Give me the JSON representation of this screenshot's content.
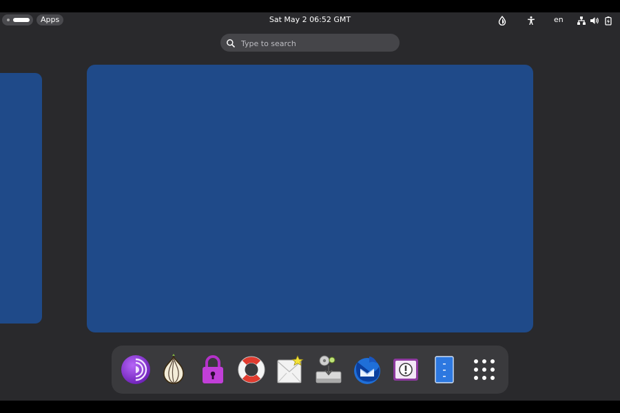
{
  "topbar": {
    "workspace_indicator": "workspace-indicator",
    "apps_label": "Apps",
    "clock": "Sat May 2  06:52 GMT",
    "tray": {
      "icons": [
        "privacy-icon",
        "accessibility-icon",
        "network-icon",
        "volume-icon",
        "battery-icon"
      ],
      "language": "en"
    }
  },
  "search": {
    "placeholder": "Type to search",
    "value": ""
  },
  "workspaces": {
    "background_color": "#1f4a89"
  },
  "dock": {
    "apps": [
      {
        "name": "tor-browser-icon"
      },
      {
        "name": "onion-circuits-icon"
      },
      {
        "name": "password-lock-icon"
      },
      {
        "name": "help-lifebuoy-icon"
      },
      {
        "name": "unsafe-mail-icon"
      },
      {
        "name": "usb-installer-icon"
      },
      {
        "name": "thunderbird-icon"
      },
      {
        "name": "keepassxc-icon"
      },
      {
        "name": "file-cabinet-icon"
      },
      {
        "name": "show-apps-grid-icon"
      }
    ]
  }
}
